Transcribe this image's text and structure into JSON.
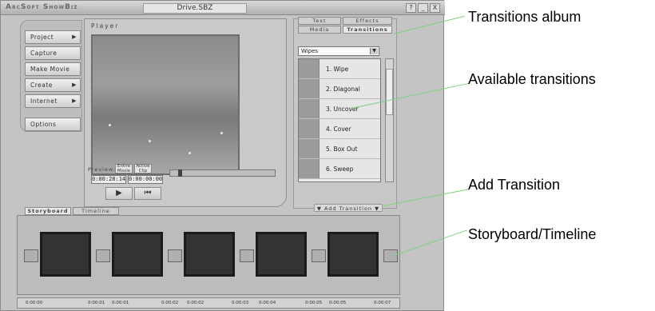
{
  "app_title": "ArcSoft ShowBiz",
  "document_title": "Drive.SBZ",
  "window_buttons": [
    "?",
    "_",
    "X"
  ],
  "left_nav": [
    "Project",
    "Capture",
    "Make Movie",
    "Create",
    "Internet",
    "Options"
  ],
  "player": {
    "label": "Player",
    "preview_label": "Preview:",
    "preview_buttons": [
      "Entire Movie",
      "Active Clip"
    ],
    "time_current": "0:00:28:14",
    "time_total": "0:00:00:00"
  },
  "tabs": {
    "text": "Text",
    "effects": "Effects",
    "media": "Media",
    "transitions": "Transitions"
  },
  "category": "Wipes",
  "transitions": [
    "1. Wipe",
    "2. Diagonal",
    "3. Uncover",
    "4. Cover",
    "5. Box Out",
    "6. Sweep"
  ],
  "add_transition_label": "Add Transition",
  "stage_tabs": [
    "Storyboard",
    "Timeline"
  ],
  "ruler": [
    "0:00:00",
    "0:00:01",
    "0:00:01",
    "0:00:02",
    "0:00:02",
    "0:00:03",
    "0:00:04",
    "0:00:05",
    "0:00:05",
    "0:00:07"
  ],
  "annotations": [
    "Transitions album",
    "Available transitions",
    "Add Transition",
    "Storyboard/Timeline"
  ]
}
